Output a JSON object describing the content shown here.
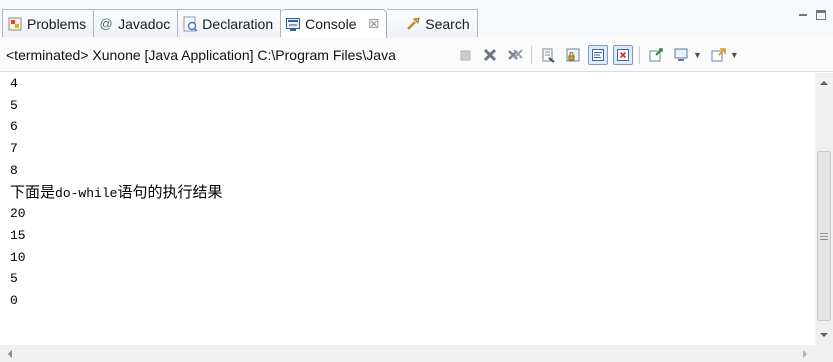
{
  "tabs": [
    {
      "label": "Problems",
      "icon": "problems-icon",
      "active": false
    },
    {
      "label": "Javadoc",
      "icon": "javadoc-icon",
      "active": false
    },
    {
      "label": "Declaration",
      "icon": "declaration-icon",
      "active": false
    },
    {
      "label": "Console",
      "icon": "console-icon",
      "active": true,
      "close": "☒"
    },
    {
      "label": "Search",
      "icon": "search-icon",
      "active": false
    }
  ],
  "toolbar": {
    "title": "<terminated> Xunone [Java Application] C:\\Program Files\\Java"
  },
  "console": {
    "lines": [
      "4",
      "5",
      "6",
      "7",
      "8"
    ],
    "heading": {
      "pre": "下面是",
      "code": "do-while",
      "post": "语句的执行结果"
    },
    "lines2": [
      "20",
      "15",
      "10",
      "5",
      "0"
    ]
  },
  "colors": {
    "console_bg": "#ffffff",
    "accent": "#7a9cc6"
  }
}
